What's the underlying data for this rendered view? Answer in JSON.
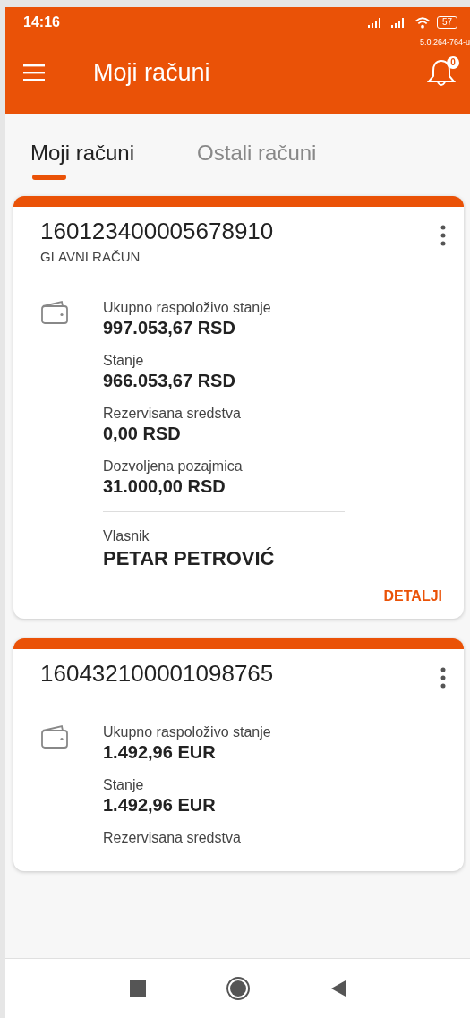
{
  "status_bar": {
    "time": "14:16",
    "build": "5.0.264-764-u",
    "battery": "57"
  },
  "app_bar": {
    "title": "Moji računi",
    "notifications": "0"
  },
  "tabs": [
    {
      "label": "Moji računi",
      "selected": true
    },
    {
      "label": "Ostali računi",
      "selected": false
    }
  ],
  "accounts": [
    {
      "number": "160123400005678910",
      "name": "GLAVNI RAČUN",
      "fields": [
        {
          "label": "Ukupno raspoloživo stanje",
          "value": "997.053,67 RSD"
        },
        {
          "label": "Stanje",
          "value": "966.053,67 RSD"
        },
        {
          "label": "Rezervisana sredstva",
          "value": "0,00 RSD"
        },
        {
          "label": "Dozvoljena pozajmica",
          "value": "31.000,00 RSD"
        }
      ],
      "owner_label": "Vlasnik",
      "owner": "PETAR PETROVIĆ",
      "action": "DETALJI"
    },
    {
      "number": "160432100001098765",
      "fields": [
        {
          "label": "Ukupno raspoloživo stanje",
          "value": "1.492,96 EUR"
        },
        {
          "label": "Stanje",
          "value": "1.492,96 EUR"
        },
        {
          "label": "Rezervisana sredstva"
        }
      ]
    }
  ]
}
